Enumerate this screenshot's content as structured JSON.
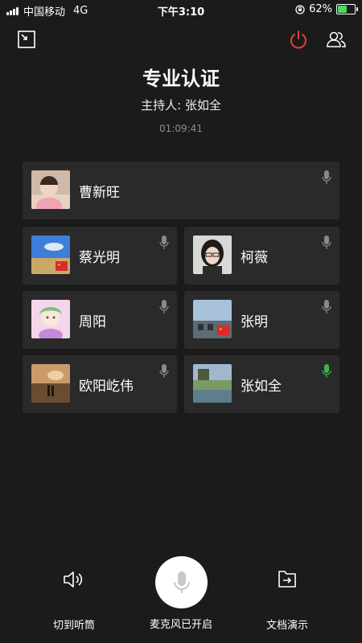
{
  "status": {
    "carrier": "中国移动",
    "network": "4G",
    "time": "下午3:10",
    "battery": "62%",
    "battery_level": 0.62
  },
  "title": "专业认证",
  "host": "主持人: 张如全",
  "timer": "01:09:41",
  "participants": [
    {
      "name": "曹新旺",
      "mic_active": false
    },
    {
      "name": "蔡光明",
      "mic_active": false
    },
    {
      "name": "柯薇",
      "mic_active": false
    },
    {
      "name": "周阳",
      "mic_active": false
    },
    {
      "name": "张明",
      "mic_active": false
    },
    {
      "name": "欧阳屹伟",
      "mic_active": false
    },
    {
      "name": "张如全",
      "mic_active": true
    }
  ],
  "bottom": {
    "speaker_label": "切到听筒",
    "mic_label": "麦克风已开启",
    "doc_label": "文档演示"
  },
  "icons": {
    "minimize": "minimize-icon",
    "power": "power-icon",
    "members": "members-icon"
  },
  "colors": {
    "power": "#e0403a",
    "mic_active": "#3cb44b",
    "mic_idle": "#8a8a8a"
  }
}
